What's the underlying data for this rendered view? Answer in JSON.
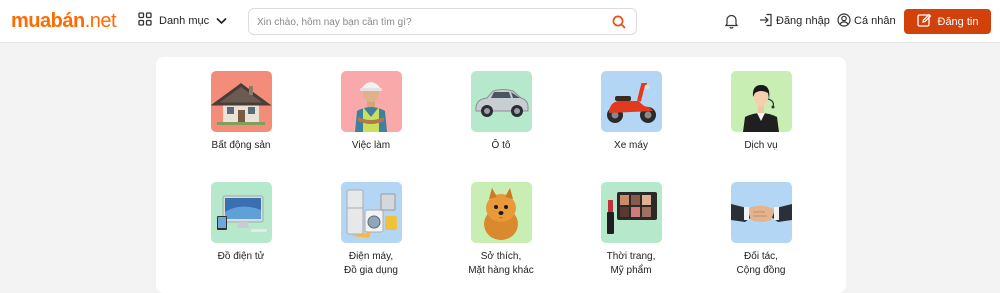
{
  "header": {
    "logo_main": "muabán",
    "logo_tld": ".net",
    "category_label": "Danh mục",
    "search_placeholder": "Xin chào, hôm nay bạn cần tìm gì?",
    "login_label": "Đăng nhập",
    "profile_label": "Cá nhân",
    "post_label": "Đăng tin"
  },
  "categories": [
    {
      "label": "Bất động sản",
      "icon": "house-image",
      "color": "#f38d79"
    },
    {
      "label": "Việc làm",
      "icon": "worker-image",
      "color": "#f9a9a9"
    },
    {
      "label": "Ô tô",
      "icon": "car-image",
      "color": "#b6e9cc"
    },
    {
      "label": "Xe máy",
      "icon": "scooter-image",
      "color": "#b3d6f5"
    },
    {
      "label": "Dịch vụ",
      "icon": "service-agent-image",
      "color": "#c9eeb3"
    },
    {
      "label": "Đồ điện tử",
      "icon": "electronics-image",
      "color": "#b6e9cc"
    },
    {
      "label": "Điện máy,\nĐồ gia dụng",
      "icon": "appliances-image",
      "color": "#b3d6f5"
    },
    {
      "label": "Sở thích,\nMặt hàng khác",
      "icon": "dog-image",
      "color": "#c9eeb3"
    },
    {
      "label": "Thời trang,\nMỹ phẩm",
      "icon": "cosmetics-image",
      "color": "#b6e9cc"
    },
    {
      "label": "Đối tác,\nCộng đồng",
      "icon": "handshake-image",
      "color": "#b3d6f5"
    }
  ],
  "colors": {
    "brand": "#ff6b00",
    "button": "#d2410a"
  }
}
